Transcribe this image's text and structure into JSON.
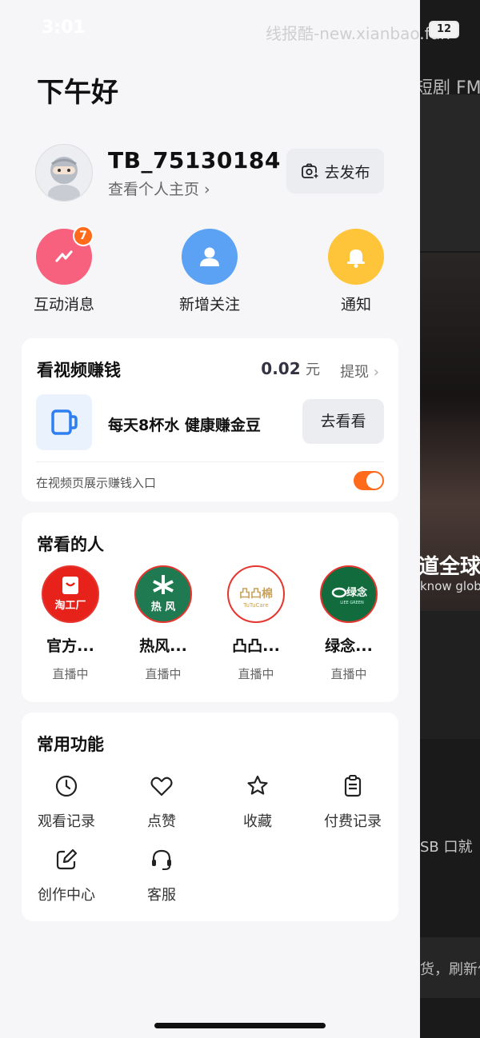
{
  "status_bar": {
    "time": "3:01",
    "watermark": "线报酷-new.xianbao.fun",
    "battery": "12"
  },
  "background": {
    "tab_text": "短剧  FM",
    "subtitle_cn": "道全球播",
    "subtitle_en": "know globa",
    "text_line1": "SB 口就",
    "text_line2": "货，刷新位"
  },
  "greeting": "下午好",
  "profile": {
    "username": "TB_75130184",
    "profile_link": "查看个人主页 ›",
    "publish_label": "去发布"
  },
  "quick_actions": [
    {
      "label": "互动消息",
      "badge": "7",
      "color": "#f7617e"
    },
    {
      "label": "新增关注",
      "color": "#5ba2f5"
    },
    {
      "label": "通知",
      "color": "#ffc53a"
    }
  ],
  "earn": {
    "title": "看视频赚钱",
    "amount": "0.02",
    "unit": "元",
    "withdraw": "提现",
    "task_text": "每天8杯水 健康赚金豆",
    "watch_label": "去看看",
    "toggle_label": "在视频页展示赚钱入口",
    "toggle_on": true,
    "accent": "#ff6a1b"
  },
  "frequent_people": {
    "title": "常看的人",
    "items": [
      {
        "name": "官方...",
        "status": "直播中",
        "logo_text": "淘工厂"
      },
      {
        "name": "热风...",
        "status": "直播中",
        "logo_text": "热 风"
      },
      {
        "name": "凸凸...",
        "status": "直播中",
        "logo_text": "凸凸棉",
        "logo_sub": "TuTuCare"
      },
      {
        "name": "绿念...",
        "status": "直播中",
        "logo_text": "绿念",
        "logo_sub": "LIEE GREEN"
      }
    ]
  },
  "functions": {
    "title": "常用功能",
    "items": [
      {
        "label": "观看记录",
        "icon": "clock-icon"
      },
      {
        "label": "点赞",
        "icon": "heart-icon"
      },
      {
        "label": "收藏",
        "icon": "star-icon"
      },
      {
        "label": "付费记录",
        "icon": "clipboard-icon"
      },
      {
        "label": "创作中心",
        "icon": "edit-icon"
      },
      {
        "label": "客服",
        "icon": "headset-icon"
      }
    ]
  }
}
